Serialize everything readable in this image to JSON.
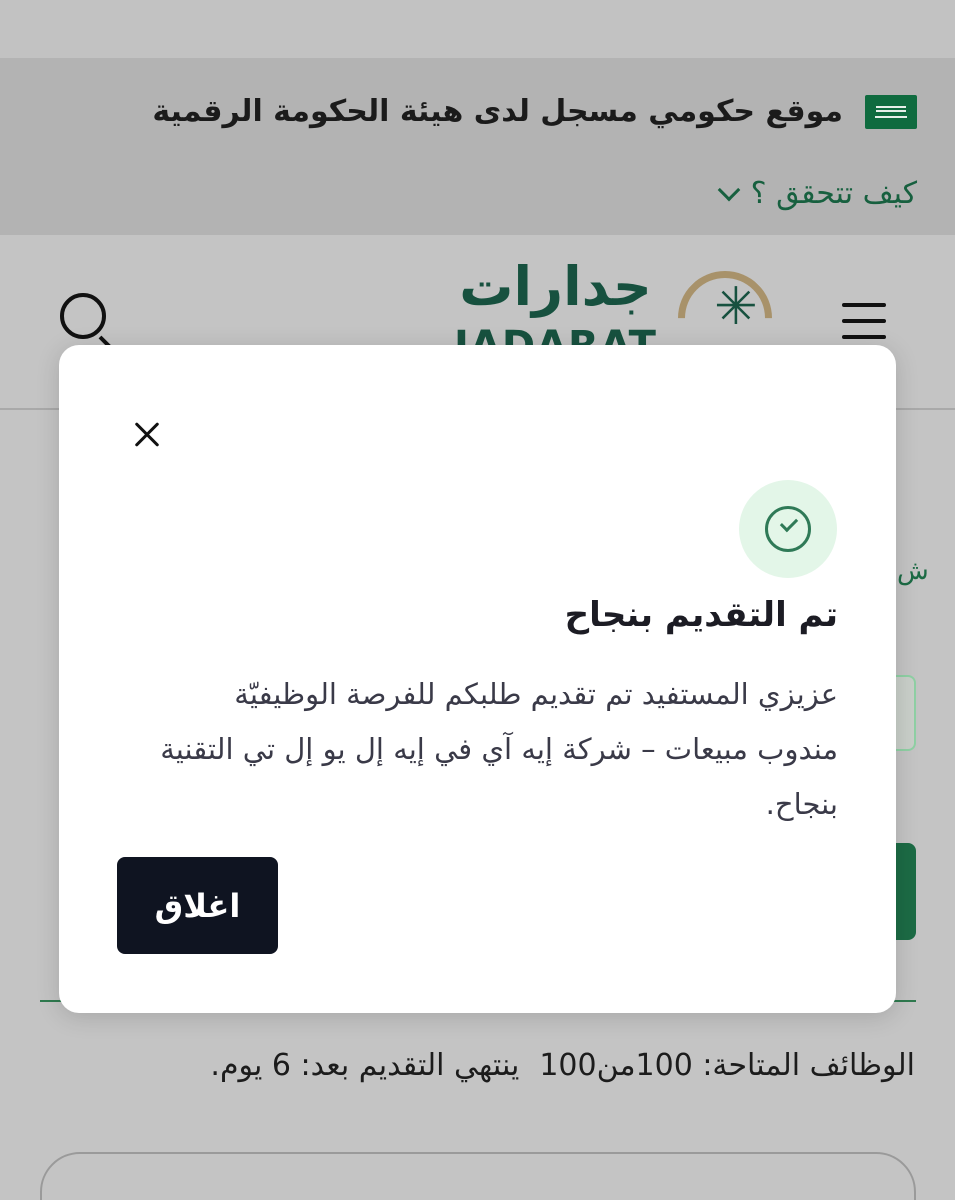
{
  "gov_banner": {
    "text": "موقع حكومي مسجل لدى هيئة الحكومة الرقمية",
    "verify_label": "كيف تتحقق ؟",
    "flag_icon": "saudi-flag-icon"
  },
  "header": {
    "logo_ar": "جدارات",
    "logo_en": "JADARAT",
    "search_icon": "search-icon",
    "menu_icon": "hamburger-menu-icon"
  },
  "modal": {
    "title": "تم التقديم بنجاح",
    "message": "عزيزي المستفيد تم تقديم طلبكم للفرصة الوظيفيّة مندوب مبيعات – شركة إيه آي في إيه إل يو إل تي التقنية بنجاح.",
    "close_button_label": "اغلاق",
    "success_icon": "check-circle-icon"
  },
  "background": {
    "jobs_available": "الوظائف المتاحة: 100من100",
    "deadline": "ينتهي التقديم بعد: 6 يوم."
  },
  "colors": {
    "brand_green": "#17513f",
    "accent_gold": "#a8926a",
    "button_dark": "#0f1421"
  }
}
